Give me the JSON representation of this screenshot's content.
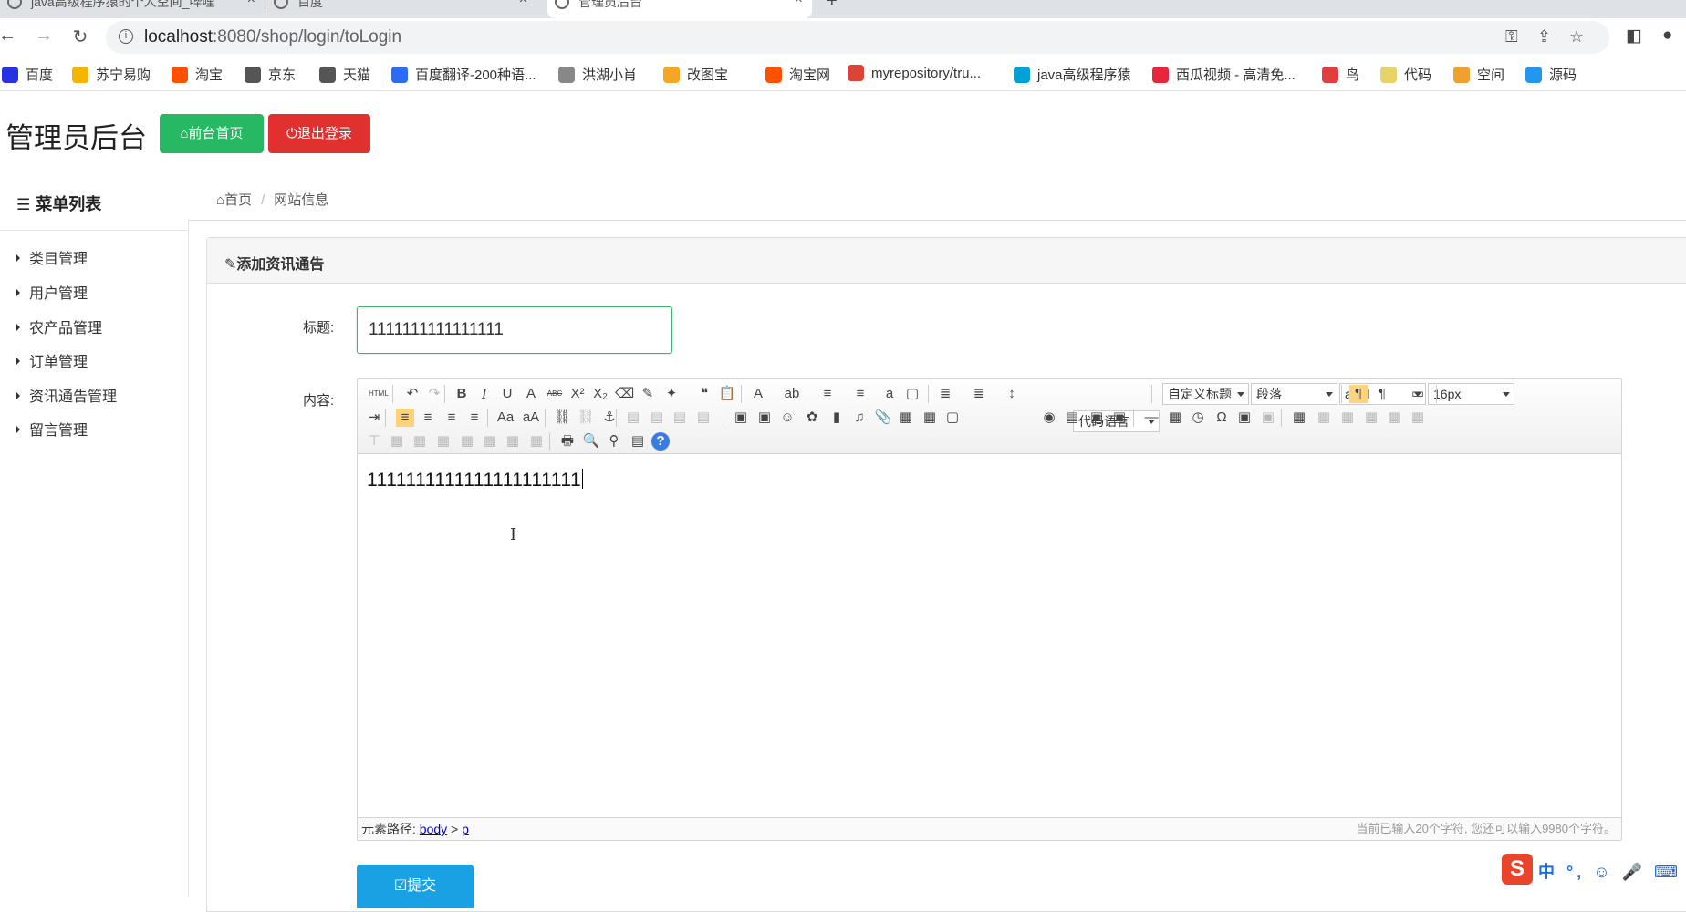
{
  "browser": {
    "tabs": [
      {
        "label": "java高级程序猿的个人空间_哔哩",
        "active": false
      },
      {
        "label": "百度",
        "active": false
      },
      {
        "label": "管理员后台",
        "active": true
      }
    ],
    "address": {
      "host": "localhost",
      "path": ":8080/shop/login/toLogin"
    },
    "bookmarks": [
      {
        "label": "百度",
        "icon": "paw-icon",
        "color": "#2932e1"
      },
      {
        "label": "苏宁易购",
        "icon": "smiley-icon",
        "color": "#f5b400"
      },
      {
        "label": "淘宝",
        "icon": "taobao-icon",
        "color": "#ff5000"
      },
      {
        "label": "京东",
        "icon": "globe-icon",
        "color": "#555555"
      },
      {
        "label": "天猫",
        "icon": "globe-icon",
        "color": "#555555"
      },
      {
        "label": "百度翻译-200种语...",
        "icon": "translate-icon",
        "color": "#2a6cf6"
      },
      {
        "label": "洪湖小肖",
        "icon": "bird-icon",
        "color": "#888888"
      },
      {
        "label": "改图宝",
        "icon": "gaitubao-icon",
        "color": "#f5a623"
      },
      {
        "label": "淘宝网",
        "icon": "taobao-icon",
        "color": "#ff5000"
      },
      {
        "label": "myrepository/tru...",
        "icon": "chrome-icon",
        "color": "#db4437"
      },
      {
        "label": "java高级程序猿",
        "icon": "bilibili-icon",
        "color": "#00a1d6"
      },
      {
        "label": "西瓜视频 - 高清免...",
        "icon": "xigua-icon",
        "color": "#e8253a"
      },
      {
        "label": "鸟",
        "icon": "bird-red-icon",
        "color": "#e43d3d"
      },
      {
        "label": "代码",
        "icon": "code-icon",
        "color": "#e6d36a"
      },
      {
        "label": "空间",
        "icon": "qzone-icon",
        "color": "#f0a030"
      },
      {
        "label": "源码",
        "icon": "docker-icon",
        "color": "#2496ed"
      }
    ]
  },
  "header": {
    "app_title": "管理员后台",
    "home_button": "前台首页",
    "logout_button": "退出登录"
  },
  "sidebar": {
    "title": "菜单列表",
    "items": [
      "类目管理",
      "用户管理",
      "农产品管理",
      "订单管理",
      "资讯通告管理",
      "留言管理"
    ]
  },
  "breadcrumb": {
    "home": "首页",
    "current": "网站信息"
  },
  "panel": {
    "heading": "添加资讯通告"
  },
  "form": {
    "title_label": "标题:",
    "title_value": "1111111111111111",
    "content_label": "内容:",
    "editor_text": "1111111111111111111111",
    "heading_select": "自定义标题",
    "paragraph_select": "段落",
    "font_select": "arial",
    "size_select": "16px",
    "code_select": "代码语言",
    "status_path_label": "元素路径:",
    "status_path_body": "body",
    "status_path_sep": ">",
    "status_path_p": "p",
    "status_count": "当前已输入20个字符, 您还可以输入9980个字符。",
    "submit_label": "提交"
  },
  "ime": {
    "logo": "S",
    "text": "中 °, ☺ 🎤 ⌨ 👤"
  },
  "colors": {
    "success": "#26b862",
    "danger": "#e0312f",
    "primary": "#1aa1e3",
    "input_border": "#3cb371"
  }
}
